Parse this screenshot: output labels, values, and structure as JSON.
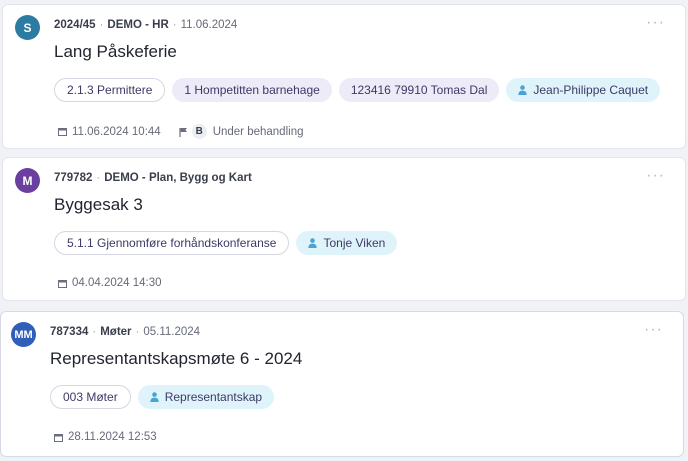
{
  "cards": [
    {
      "avatar": {
        "initials": "S",
        "color": "#2b7ba3"
      },
      "number": "2024/45",
      "unit": "DEMO - HR",
      "date": "11.06.2024",
      "title": "Lang Påskeferie",
      "chips": [
        {
          "label": "2.1.3 Permittere",
          "style": "outline"
        },
        {
          "label": "1 Hompetitten barnehage",
          "style": "purple"
        },
        {
          "label": "123416 79910 Tomas Dal",
          "style": "purple"
        },
        {
          "label": "Jean-Philippe Caquet",
          "style": "blue",
          "icon": "person-icon"
        }
      ],
      "deadline": "11.06.2024 10:44",
      "status_badge": "B",
      "status_text": "Under behandling"
    },
    {
      "avatar": {
        "initials": "M",
        "color": "#6a3fa0"
      },
      "number": "779782",
      "unit": "DEMO - Plan, Bygg og Kart",
      "title": "Byggesak 3",
      "chips": [
        {
          "label": "5.1.1 Gjennomføre forhåndskonferanse",
          "style": "outline"
        },
        {
          "label": "Tonje Viken",
          "style": "blue",
          "icon": "person-icon"
        }
      ],
      "deadline": "04.04.2024 14:30"
    },
    {
      "avatar": {
        "initials": "MM",
        "color": "#2f5fb8"
      },
      "number": "787334",
      "unit": "Møter",
      "date": "05.11.2024",
      "title": "Representantskapsmøte 6 - 2024",
      "chips": [
        {
          "label": "003 Møter",
          "style": "outline"
        },
        {
          "label": "Representantskap",
          "style": "blue",
          "icon": "person-icon"
        }
      ],
      "deadline": "28.11.2024 12:53"
    }
  ],
  "icons": {
    "more": "more-horizontal-icon",
    "calendar": "calendar-icon",
    "flag": "flag-icon",
    "person": "person-icon"
  }
}
